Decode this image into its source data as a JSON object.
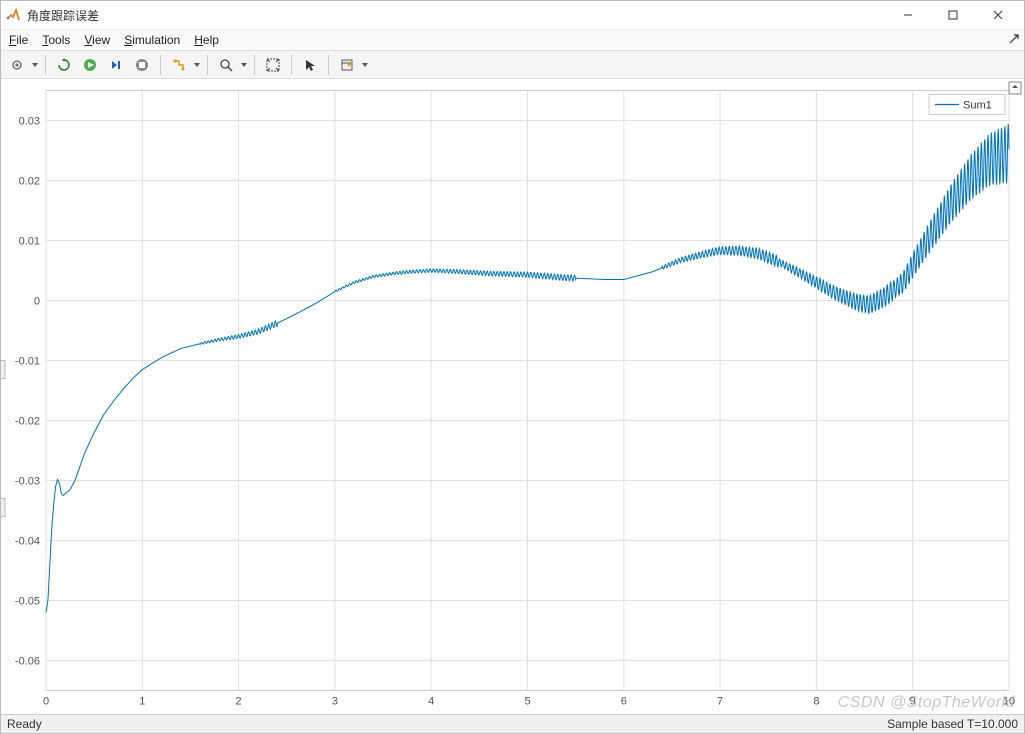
{
  "window": {
    "title": "角度跟踪误差"
  },
  "menu": {
    "file": "File",
    "tools": "Tools",
    "view": "View",
    "simulation": "Simulation",
    "help": "Help"
  },
  "toolbar": {
    "print": "print-icon",
    "back": "back-icon",
    "run": "run-icon",
    "step": "step-icon",
    "stop": "stop-icon",
    "highlight": "highlight-icon",
    "zoom": "zoom-icon",
    "fit": "fit-icon",
    "cursor": "cursor-icon",
    "edit": "edit-icon"
  },
  "legend": {
    "series1": "Sum1"
  },
  "statusbar": {
    "ready": "Ready",
    "sample": "Sample based  T=10.000"
  },
  "watermark": "CSDN @StopTheWorld",
  "chart_data": {
    "type": "line",
    "xlim": [
      0,
      10
    ],
    "ylim": [
      -0.065,
      0.035
    ],
    "x_ticks": [
      0,
      1,
      2,
      3,
      4,
      5,
      6,
      7,
      8,
      9,
      10
    ],
    "y_ticks": [
      -0.06,
      -0.05,
      -0.04,
      -0.03,
      -0.02,
      -0.01,
      0,
      0.01,
      0.02,
      0.03
    ],
    "x_tick_labels": [
      "0",
      "1",
      "2",
      "3",
      "4",
      "5",
      "6",
      "7",
      "8",
      "9",
      "10"
    ],
    "y_tick_labels": [
      "-0.06",
      "-0.05",
      "-0.04",
      "-0.03",
      "-0.02",
      "-0.01",
      "0",
      "0.01",
      "0.02",
      "0.03"
    ],
    "series": [
      {
        "name": "Sum1",
        "color": "#0072BD",
        "data": [
          [
            0.0,
            -0.052
          ],
          [
            0.02,
            -0.05
          ],
          [
            0.04,
            -0.044
          ],
          [
            0.06,
            -0.038
          ],
          [
            0.08,
            -0.034
          ],
          [
            0.1,
            -0.031
          ],
          [
            0.12,
            -0.0298
          ],
          [
            0.14,
            -0.0305
          ],
          [
            0.16,
            -0.0322
          ],
          [
            0.18,
            -0.0325
          ],
          [
            0.2,
            -0.0322
          ],
          [
            0.25,
            -0.0315
          ],
          [
            0.3,
            -0.03
          ],
          [
            0.4,
            -0.0255
          ],
          [
            0.5,
            -0.022
          ],
          [
            0.6,
            -0.019
          ],
          [
            0.7,
            -0.0168
          ],
          [
            0.8,
            -0.0148
          ],
          [
            0.9,
            -0.013
          ],
          [
            1.0,
            -0.0115
          ],
          [
            1.2,
            -0.0095
          ],
          [
            1.4,
            -0.008
          ],
          [
            1.6,
            -0.0072
          ],
          [
            1.8,
            -0.0065
          ],
          [
            2.0,
            -0.006
          ],
          [
            2.2,
            -0.0052
          ],
          [
            2.4,
            -0.0038
          ],
          [
            2.6,
            -0.0022
          ],
          [
            2.8,
            -0.0005
          ],
          [
            3.0,
            0.0015
          ],
          [
            3.2,
            0.003
          ],
          [
            3.4,
            0.004
          ],
          [
            3.6,
            0.0045
          ],
          [
            3.8,
            0.0048
          ],
          [
            4.0,
            0.005
          ],
          [
            4.3,
            0.0048
          ],
          [
            4.6,
            0.0045
          ],
          [
            5.0,
            0.0043
          ],
          [
            5.4,
            0.0038
          ],
          [
            5.8,
            0.0035
          ],
          [
            6.0,
            0.0035
          ],
          [
            6.3,
            0.0048
          ],
          [
            6.6,
            0.0068
          ],
          [
            6.9,
            0.008
          ],
          [
            7.0,
            0.0083
          ],
          [
            7.2,
            0.0083
          ],
          [
            7.4,
            0.0078
          ],
          [
            7.6,
            0.0065
          ],
          [
            7.8,
            0.0048
          ],
          [
            8.0,
            0.003
          ],
          [
            8.2,
            0.0012
          ],
          [
            8.4,
            -0.0002
          ],
          [
            8.55,
            -0.0007
          ],
          [
            8.7,
            0.0005
          ],
          [
            8.9,
            0.003
          ],
          [
            9.0,
            0.0058
          ],
          [
            9.2,
            0.0112
          ],
          [
            9.4,
            0.0162
          ],
          [
            9.6,
            0.0205
          ],
          [
            9.8,
            0.0235
          ],
          [
            10.0,
            0.0245
          ]
        ],
        "oscillation": [
          {
            "x_start": 1.6,
            "x_end": 2.4,
            "amp": 0.0005
          },
          {
            "x_start": 3.0,
            "x_end": 5.5,
            "amp": 0.0005
          },
          {
            "x_start": 6.4,
            "x_end": 7.6,
            "amp": 0.001
          },
          {
            "x_start": 7.6,
            "x_end": 8.8,
            "amp": 0.0018
          },
          {
            "x_start": 8.8,
            "x_end": 10.0,
            "amp": 0.005
          }
        ]
      }
    ]
  }
}
